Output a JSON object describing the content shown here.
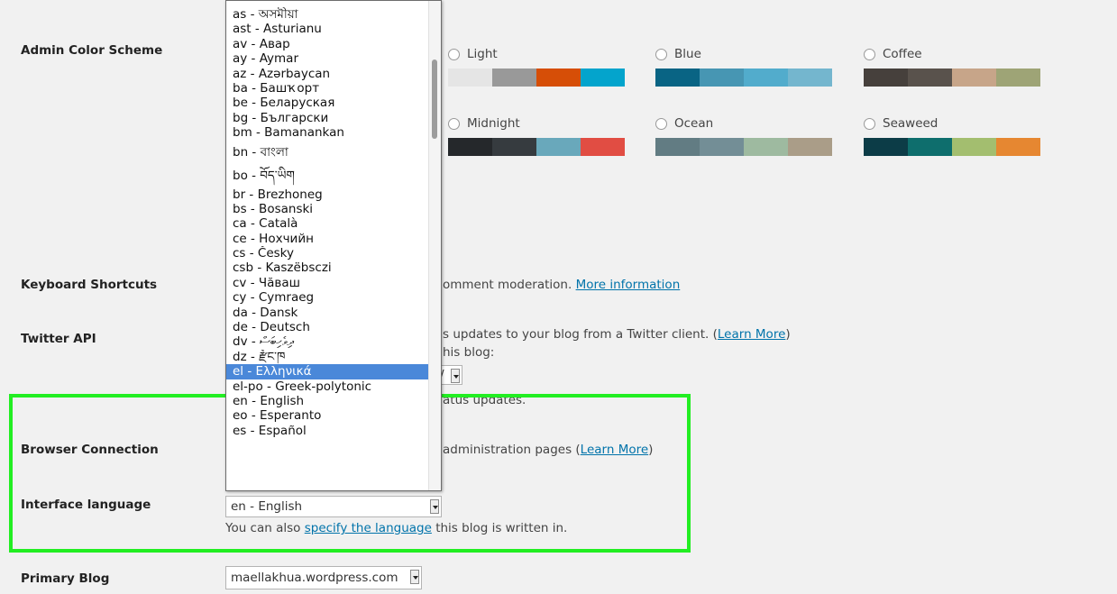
{
  "labels": {
    "admin_color_scheme": "Admin Color Scheme",
    "keyboard_shortcuts": "Keyboard Shortcuts",
    "twitter_api": "Twitter API",
    "browser_connection": "Browser Connection",
    "interface_language": "Interface language",
    "primary_blog": "Primary Blog"
  },
  "color_schemes": [
    {
      "name": "Light",
      "colors": [
        "#e5e5e5",
        "#999999",
        "#d64e07",
        "#04a4cc"
      ]
    },
    {
      "name": "Blue",
      "colors": [
        "#096484",
        "#4796b3",
        "#52accc",
        "#74b6ce"
      ]
    },
    {
      "name": "Coffee",
      "colors": [
        "#46403c",
        "#59524c",
        "#c7a589",
        "#9ea476"
      ]
    },
    {
      "name": "Midnight",
      "colors": [
        "#25282b",
        "#363b3f",
        "#69a8bb",
        "#e14d43"
      ]
    },
    {
      "name": "Ocean",
      "colors": [
        "#627c83",
        "#738e96",
        "#9ebaa0",
        "#aa9d88"
      ]
    },
    {
      "name": "Seaweed",
      "colors": [
        "#0c3c47",
        "#0e6e6d",
        "#a3be6f",
        "#e68731"
      ]
    }
  ],
  "keyboard": {
    "text_partial": "omment moderation.",
    "link": "More information"
  },
  "twitter": {
    "line1_partial": "s updates to your blog from a Twitter client. (",
    "line1_link": "Learn More",
    "line1_end": ")",
    "line2_partial": "his blog:",
    "select_partial": "/",
    "line3_partial": "atus updates."
  },
  "browser": {
    "text_partial": "administration pages (",
    "link": "Learn More",
    "end": ")"
  },
  "interface_language": {
    "selected": "en - English",
    "help_prefix": "You can also ",
    "help_link": "specify the language",
    "help_suffix": " this blog is written in."
  },
  "primary_blog": {
    "selected": "maellakhua.wordpress.com"
  },
  "dropdown": {
    "items": [
      "as - অসমীয়া",
      "ast - Asturianu",
      "av - Авар",
      "ay - Aymar",
      "az - Azərbaycan",
      "ba - Башҡорт",
      "be - Беларуская",
      "bg - Български",
      "bm - Bamanankan",
      "bn - বাংলা",
      "bo - བོད་ཡིག",
      "br - Brezhoneg",
      "bs - Bosanski",
      "ca - Català",
      "ce - Нохчийн",
      "cs - Česky",
      "csb - Kaszëbsczi",
      "cv - Чăваш",
      "cy - Cymraeg",
      "da - Dansk",
      "de - Deutsch",
      "dv - ދިވެހިބަސް",
      "dz - རྫོང་ཁ",
      "el - Ελληνικά",
      "el-po - Greek-polytonic",
      "en - English",
      "eo - Esperanto",
      "es - Español"
    ],
    "selected_index": 23
  },
  "highlight_color": "#22ee22"
}
